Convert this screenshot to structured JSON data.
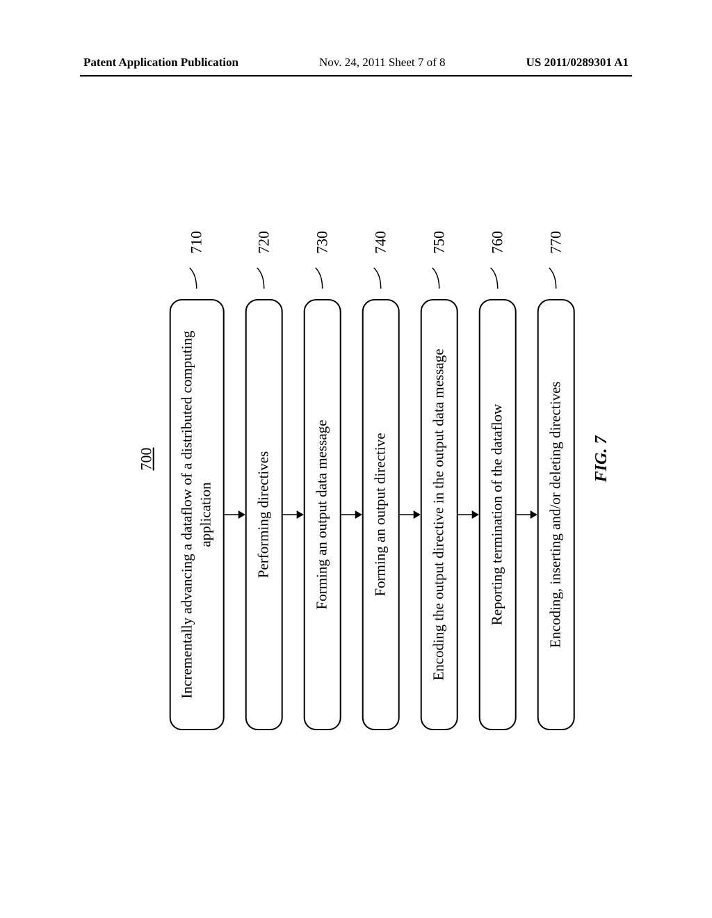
{
  "header": {
    "left": "Patent Application Publication",
    "center": "Nov. 24, 2011  Sheet 7 of 8",
    "right": "US 2011/0289301 A1"
  },
  "flow": {
    "number": "700",
    "steps": [
      {
        "label": "710",
        "text": "Incrementally advancing a dataflow of a distributed computing application"
      },
      {
        "label": "720",
        "text": "Performing directives"
      },
      {
        "label": "730",
        "text": "Forming an output data message"
      },
      {
        "label": "740",
        "text": "Forming an output directive"
      },
      {
        "label": "750",
        "text": "Encoding the output directive in the output data message"
      },
      {
        "label": "760",
        "text": "Reporting termination of the dataflow"
      },
      {
        "label": "770",
        "text": "Encoding, inserting and/or deleting directives"
      }
    ]
  },
  "figure_caption": "FIG. 7"
}
